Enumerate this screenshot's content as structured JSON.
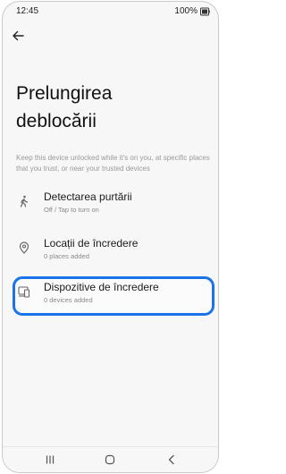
{
  "status_bar": {
    "time": "12:45",
    "battery": "100%"
  },
  "header": {
    "title_line1": "Prelungirea",
    "title_line2": "deblocării"
  },
  "description": "Keep this device unlocked while it's on you, at specific places that you trust, or near your trusted devices",
  "items": [
    {
      "title": "Detectarea purtării",
      "subtitle": "Off / Tap to turn on",
      "icon": "walking-person-icon"
    },
    {
      "title": "Locații de încredere",
      "subtitle": "0 places added",
      "icon": "location-pin-icon"
    },
    {
      "title": "Dispozitive de încredere",
      "subtitle": "0 devices added",
      "icon": "devices-icon"
    }
  ],
  "highlight_color": "#1a73e8"
}
